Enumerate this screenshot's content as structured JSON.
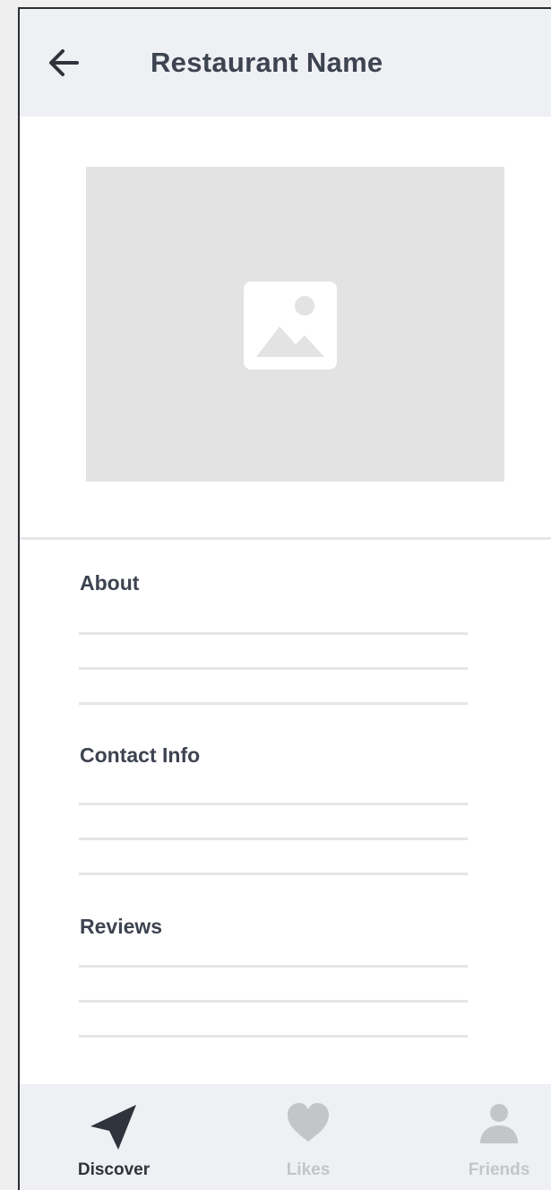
{
  "header": {
    "title": "Restaurant Name",
    "back_icon": "arrow-left-icon"
  },
  "hero": {
    "icon": "image-placeholder-icon"
  },
  "sections": [
    {
      "title": "About"
    },
    {
      "title": "Contact Info"
    },
    {
      "title": "Reviews"
    }
  ],
  "nav": {
    "items": [
      {
        "label": "Discover",
        "icon": "navigation-arrow-icon",
        "active": true
      },
      {
        "label": "Likes",
        "icon": "heart-icon",
        "active": false
      },
      {
        "label": "Friends",
        "icon": "person-icon",
        "active": false
      }
    ]
  },
  "colors": {
    "text_dark": "#3d4350",
    "nav_active": "#2f333b",
    "nav_inactive": "#c4c5c9",
    "header_bg": "#eff0f4",
    "placeholder_bg": "#e3e3e3"
  }
}
